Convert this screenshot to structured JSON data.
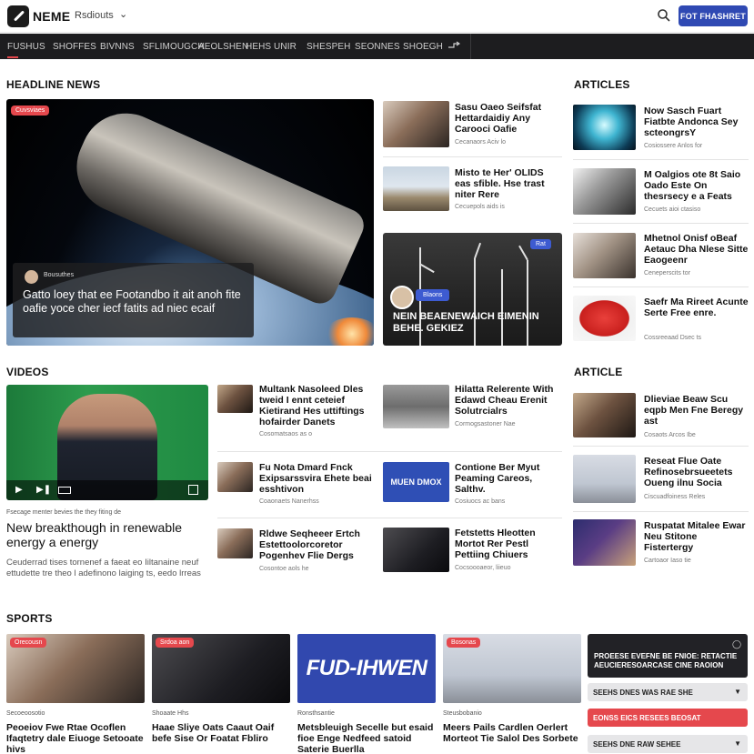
{
  "header": {
    "logo": "NEME",
    "region": "Rsdiouts",
    "subscribe": "FOT FHASHRET"
  },
  "nav": {
    "items": [
      "FUSHUS",
      "SHOFFES",
      "BIVNNS",
      "SFLIMOUGCH",
      "AEOLSHEN",
      "HEHS UNIR",
      "SHESPEH",
      "SEONNES",
      "SHOEGH"
    ]
  },
  "headline": {
    "section_title": "HEADLINE NEWS",
    "hero": {
      "badge": "Cuvsviaes",
      "byline": "Bousuthes",
      "text": "Gatto loey that ee Footandbo it ait anoh fite oafie yoce cher iecf fatits ad niec ecaif"
    },
    "list": [
      {
        "title": "Sasu Oaeo Seifsfat Hettardaidiy Any Carooci Oafie",
        "meta": "Cecanaors Aciv lo"
      },
      {
        "title": "Misto te Her' OLIDS eas sfible. Hse trast niter Rere",
        "meta": "Cecuepols aids is"
      }
    ],
    "wind": {
      "badge": "Rat",
      "tag": "Blaons",
      "text": "NEIN BEAENEWAICH EIMENIN BEHE. GEKIEZ"
    }
  },
  "articles": {
    "section_title": "ARTICLES",
    "items": [
      {
        "title": "Now Sasch Fuart Fiatbte Andonca Sey scteongrsY",
        "meta": "Cosiossere Anlos for"
      },
      {
        "title": "M Oalgios ote 8t Saio Oado Este On thesrsecy e a Feats",
        "meta": "Cecuets aioi ctasiso"
      },
      {
        "title": "Mhetnol Onisf oBeaf Aetauc Dha Nlese Sitte Eaogeenr",
        "meta": "Ceneperscits tor"
      },
      {
        "title": "Saefr Ma Rireet Acunte Serte Free enre.",
        "meta": "Cossreeaad Dsec ts"
      }
    ]
  },
  "videos": {
    "section_title": "VIDEOS",
    "caption": "Fsecage menter bevies the they fiting de",
    "title": "New breakthough in renewable energy a energy",
    "desc": "Ceuderrad tises tornenef a faeat eo Iiltanaine neuf ettudette tre theo l adefinono laiging ts, eedo lrreas",
    "list": [
      {
        "title": "Multank Nasoleed Dles tweid I ennt ceteief Kietirand Hes uttiftings hofairder Danets",
        "meta": "Cosomatsaos as o"
      },
      {
        "title": "Hilatta Relerente With Edawd Cheau Erenit Solutrcialrs",
        "meta": "Cormogsastoner Nae"
      },
      {
        "title": "Fu Nota Dmard Fnck Exipsarssvira Ehete beai esshtivon",
        "meta": "Coaonaets Nanerhss"
      },
      {
        "title": "Contione Ber Myut Peaming Careos, Salthv.",
        "meta": "Cosiuocs ac bans"
      },
      {
        "title": "Rldwe Seqheeer Ertch Estettoolorcoretor Pogenhev Flie Dergs",
        "meta": "Cosontoe aols he"
      },
      {
        "title": "Fetstetts Hleotten Mortot Rer Pestl Pettiing Chiuers",
        "meta": "Cocsoooaeor, liieuo"
      }
    ],
    "blue_thumb": "MUEN DMOX"
  },
  "article2": {
    "section_title": "ARTICLE",
    "items": [
      {
        "title": "Dlieviae Beaw Scu eqpb Men Fne Beregy ast",
        "meta": "Cosaots Arcos Ibe"
      },
      {
        "title": "Reseat Flue Oate Refinosebrsueetets Oueng ilnu Socia",
        "meta": "Ciscuadfoiness Reles"
      },
      {
        "title": "Ruspatat Mitalee Ewar Neu Stitone Fistertergy",
        "meta": "Cartoaor Iaso tie"
      }
    ]
  },
  "sports": {
    "section_title": "SPORTS",
    "cards": [
      {
        "badge": "Orecousn",
        "meta": "Secoeoosotio",
        "title": "Peoeiov Fwe Rtae Ocoflen Ifaqtetry dale Eiuoge Setooate hivs"
      },
      {
        "badge": "Srdoa aon",
        "meta": "Shoaate Hhs",
        "title": "Haae Sliye Oats Caaut Oaif befe Sise Or Foatat Fbliro"
      },
      {
        "badge": "",
        "meta": "Ronsthsantie",
        "title": "Metsbleuigh Secelle but esaid fioe Enge Nedfeed satoid Saterie Buerlla"
      },
      {
        "badge": "Bosonas",
        "meta": "Steusbobanio",
        "title": "Meers Pails Cardlen Oerlert Morteot Tie Salol Des Sorbete"
      }
    ],
    "sport3_logo": "FUD-IHWEN",
    "scores": {
      "panel_text": "PROEESE EVEFNE BE FNIOE: RETACTIE AEUCIERESOARCASE CINE RAOION",
      "rows": [
        "SEEHS DNES WAS RAE SHE",
        "EONSS EICS RESEES BEOSAT",
        "SEEHS DNE RAW SEHEE"
      ]
    }
  },
  "colors": {
    "accent_blue": "#2f49b3",
    "badge_red": "#e5484d",
    "nav_bg": "#1d1d1f"
  }
}
